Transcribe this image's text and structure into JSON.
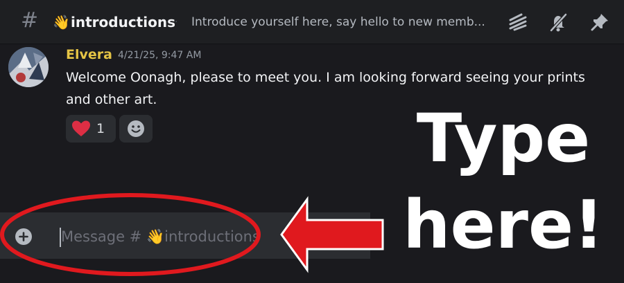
{
  "header": {
    "channel_emoji": "👋",
    "channel_name": "introductions",
    "separator": "·",
    "topic": "Introduce yourself here, say hello to new memb..."
  },
  "icons": {
    "hash": "hash-icon",
    "threads": "threads-icon",
    "notifications_muted": "bell-slash-icon",
    "pinned": "pin-icon",
    "reaction_emoji": "red-heart",
    "add_reaction": "smiley-icon",
    "attach": "plus-circle-icon"
  },
  "message": {
    "author": "Elvera",
    "timestamp": "4/21/25, 9:47 AM",
    "text": "Welcome Oonagh, please to meet you. I am looking forward seeing your prints and other art.",
    "reaction_count": "1"
  },
  "composer": {
    "placeholder": "Message # 👋introductions"
  },
  "annotation": {
    "line1": "Type",
    "line2": "here!",
    "color": "#e0191e"
  },
  "colors": {
    "background": "#1a1a1e",
    "author": "#e5c445",
    "reaction_bg": "#2b2d31"
  }
}
